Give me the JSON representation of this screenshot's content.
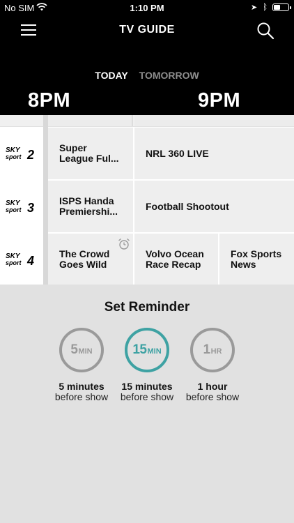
{
  "status": {
    "carrier": "No SIM",
    "time": "1:10 PM"
  },
  "header": {
    "title": "TV GUIDE",
    "icons": {
      "menu": "hamburger-menu-icon",
      "search": "search-icon"
    }
  },
  "day_tabs": [
    "TODAY",
    "TOMORROW"
  ],
  "active_day": "TODAY",
  "hours": [
    "8PM",
    "9PM"
  ],
  "channels": [
    {
      "logo_word": "SKY",
      "logo_sub": "sport",
      "logo_num": "2",
      "programs": [
        {
          "line1": "Super",
          "line2": "League Ful..."
        },
        {
          "line1": "NRL 360 LIVE",
          "line2": ""
        }
      ]
    },
    {
      "logo_word": "SKY",
      "logo_sub": "sport",
      "logo_num": "3",
      "programs": [
        {
          "line1": "ISPS Handa",
          "line2": "Premiershi..."
        },
        {
          "line1": "Football Shootout",
          "line2": ""
        }
      ]
    },
    {
      "logo_word": "SKY",
      "logo_sub": "sport",
      "logo_num": "4",
      "programs": [
        {
          "line1": "The Crowd",
          "line2": "Goes Wild",
          "reminder_icon": "alarm-clock-icon"
        },
        {
          "line1": "Volvo Ocean",
          "line2": "Race Recap"
        },
        {
          "line1": "Fox Sports",
          "line2": "News"
        }
      ]
    }
  ],
  "reminder": {
    "heading": "Set Reminder",
    "options": [
      {
        "num": "5",
        "unit": "MIN",
        "label": "5 minutes",
        "sub": "before show",
        "selected": false
      },
      {
        "num": "15",
        "unit": "MIN",
        "label": "15 minutes",
        "sub": "before show",
        "selected": true
      },
      {
        "num": "1",
        "unit": "HR",
        "label": "1 hour",
        "sub": "before show",
        "selected": false
      }
    ],
    "accent_color": "#3ea2a3",
    "inactive_color": "#9a9a9a"
  }
}
